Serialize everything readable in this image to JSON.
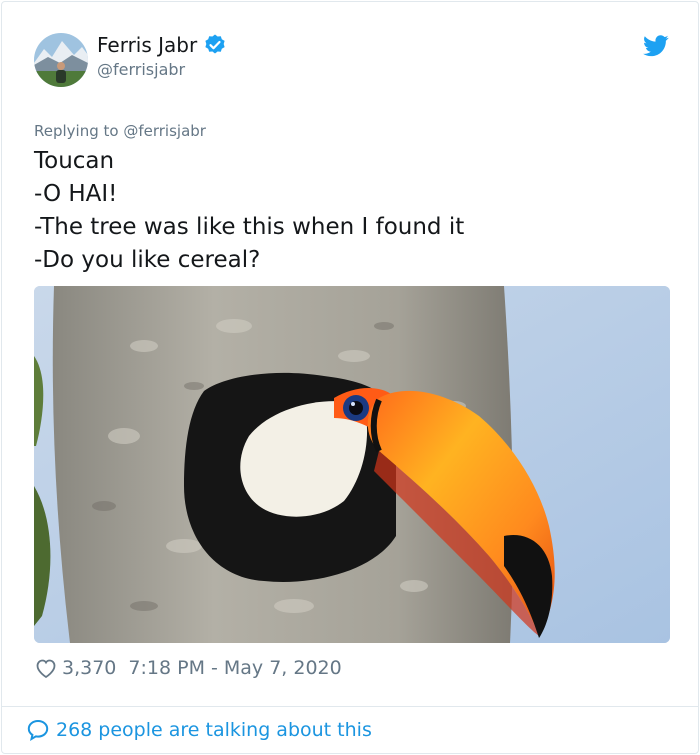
{
  "tweet": {
    "author_name": "Ferris Jabr",
    "author_handle": "@ferrisjabr",
    "replying_to": "Replying to @ferrisjabr",
    "lines": [
      "Toucan",
      "-O HAI!",
      "-The tree was like this when I found it",
      "-Do you like cereal?"
    ],
    "likes": "3,370",
    "timestamp": "7:18 PM - May 7, 2020",
    "talking": "268 people are talking about this"
  },
  "icons": {
    "verified": "verified-badge-icon",
    "twitter": "twitter-bird-icon",
    "like": "heart-icon",
    "reply": "speech-bubble-icon"
  },
  "colors": {
    "twitter_blue": "#1da1f2",
    "link_blue": "#1b95e0",
    "secondary_text": "#657786",
    "primary_text": "#14171a"
  }
}
